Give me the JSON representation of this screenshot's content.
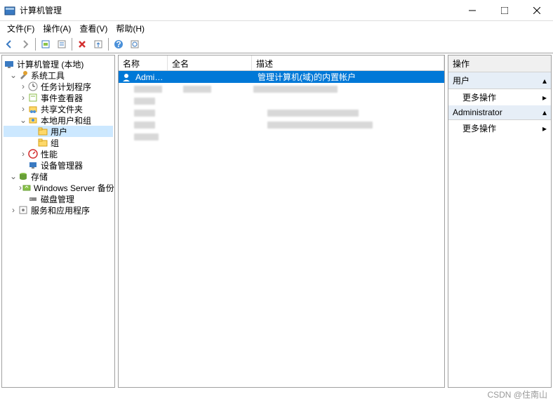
{
  "title": "计算机管理",
  "menubar": {
    "file": "文件(F)",
    "action": "操作(A)",
    "view": "查看(V)",
    "help": "帮助(H)"
  },
  "tree": {
    "root": "计算机管理 (本地)",
    "systemTools": "系统工具",
    "taskScheduler": "任务计划程序",
    "eventViewer": "事件查看器",
    "sharedFolders": "共享文件夹",
    "localUsersGroups": "本地用户和组",
    "users": "用户",
    "groups": "组",
    "performance": "性能",
    "deviceManager": "设备管理器",
    "storage": "存储",
    "windowsServerBackup": "Windows Server 备份",
    "diskManagement": "磁盘管理",
    "servicesApps": "服务和应用程序"
  },
  "list": {
    "headers": {
      "name": "名称",
      "fullname": "全名",
      "desc": "描述"
    },
    "row0": {
      "name": "Administrat...",
      "fullname": "",
      "desc": "管理计算机(域)的内置帐户"
    }
  },
  "actions": {
    "title": "操作",
    "section1": "用户",
    "section2": "Administrator",
    "moreActions": "更多操作"
  },
  "watermark": "CSDN @住南山"
}
